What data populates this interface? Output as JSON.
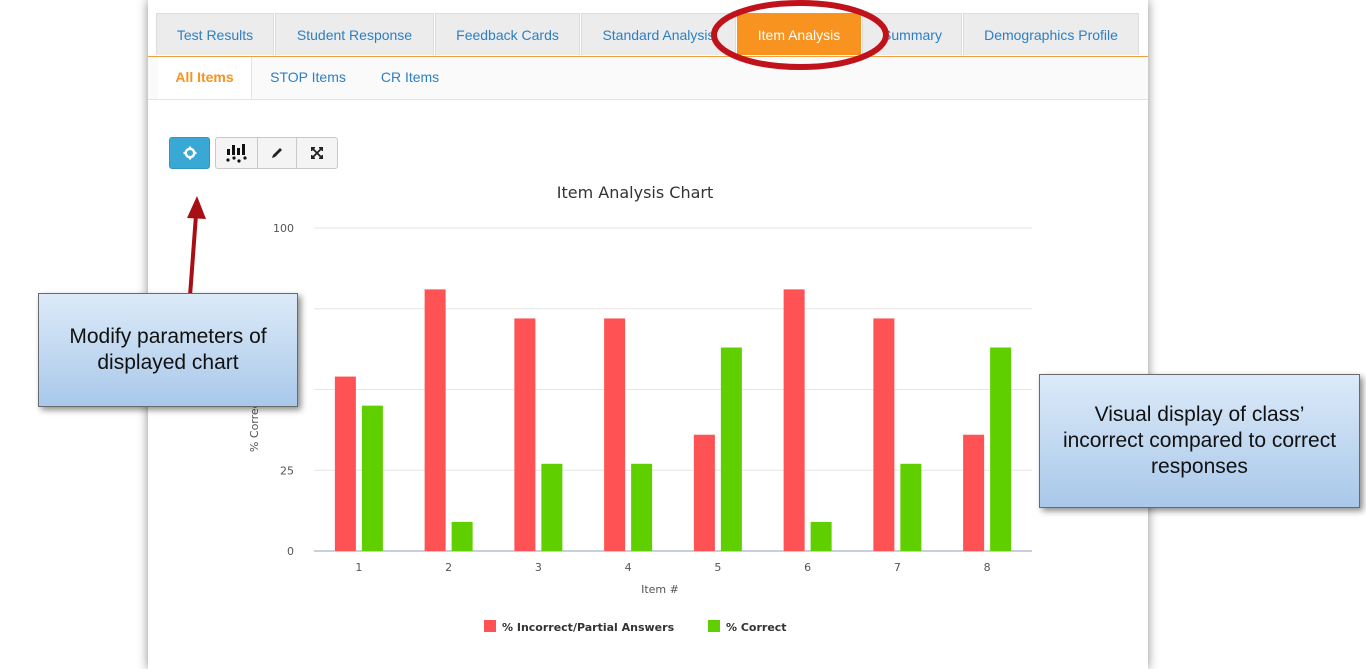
{
  "tabs": [
    {
      "label": "Test Results",
      "active": false
    },
    {
      "label": "Student Response",
      "active": false
    },
    {
      "label": "Feedback Cards",
      "active": false
    },
    {
      "label": "Standard Analysis",
      "active": false
    },
    {
      "label": "Item Analysis",
      "active": true
    },
    {
      "label": "Summary",
      "active": false
    },
    {
      "label": "Demographics Profile",
      "active": false
    }
  ],
  "subtabs": [
    {
      "label": "All Items",
      "active": true
    },
    {
      "label": "STOP Items",
      "active": false
    },
    {
      "label": "CR Items",
      "active": false
    }
  ],
  "toolbar": {
    "icons": [
      "gear-icon",
      "chart-type-icon",
      "pencil-icon",
      "expand-icon"
    ]
  },
  "callouts": {
    "left": "Modify parameters of displayed chart",
    "right": "Visual display of class’ incorrect compared to correct responses"
  },
  "colors": {
    "incorrect": "#ff5254",
    "correct": "#5fcf00",
    "accent": "#f7931e",
    "highlight_ellipse": "#c0121a"
  },
  "chart_data": {
    "type": "bar",
    "title": "Item Analysis Chart",
    "xlabel": "Item #",
    "ylabel": "% Correct",
    "categories": [
      "1",
      "2",
      "3",
      "4",
      "5",
      "6",
      "7",
      "8"
    ],
    "series": [
      {
        "name": "% Incorrect/Partial Answers",
        "values": [
          54,
          81,
          72,
          72,
          36,
          81,
          72,
          36
        ]
      },
      {
        "name": "% Correct",
        "values": [
          45,
          9,
          27,
          27,
          63,
          9,
          27,
          63
        ]
      }
    ],
    "yticks": [
      0,
      25,
      100
    ],
    "ylim": [
      0,
      100
    ],
    "legend_position": "bottom",
    "grid": true
  }
}
